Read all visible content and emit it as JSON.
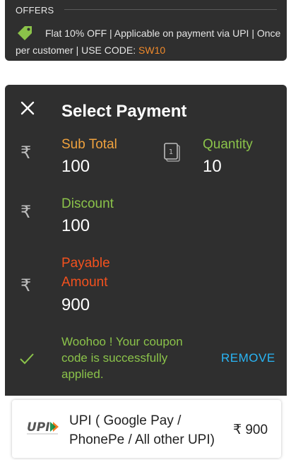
{
  "offers": {
    "title": "OFFERS",
    "text": "Flat 10% OFF | Applicable on payment via UPI | Once per customer | USE CODE: ",
    "code": "SW10",
    "code_color": "#f08a2b"
  },
  "payment": {
    "title": "Select Payment",
    "currency_symbol": "₹",
    "sub_total": {
      "label": "Sub Total",
      "value": "100"
    },
    "quantity": {
      "label": "Quantity",
      "value": "10",
      "icon_text": "1"
    },
    "discount": {
      "label": "Discount",
      "value": "100"
    },
    "payable": {
      "label_line1": "Payable",
      "label_line2": "Amount",
      "value": "900"
    },
    "coupon_message": "Woohoo ! Your coupon code is successfully applied.",
    "remove_label": "REMOVE"
  },
  "upi_option": {
    "logo_text": "UPI",
    "label": "UPI ( Google Pay / PhonePe / All other UPI)",
    "amount": "₹ 900"
  },
  "colors": {
    "sub_total": "#f0a23e",
    "discount": "#8bc34a",
    "payable": "#f4511e",
    "remove": "#29b6f6"
  }
}
